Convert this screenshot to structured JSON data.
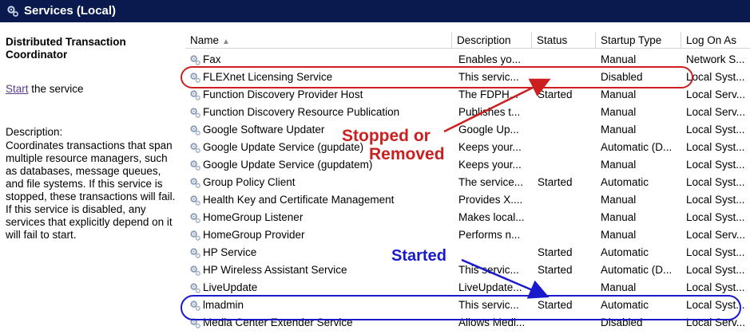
{
  "window": {
    "title": "Services (Local)"
  },
  "left_pane": {
    "service_name": "Distributed Transaction Coordinator",
    "action_link": "Start",
    "action_suffix": " the service",
    "description_label": "Description:",
    "description": "Coordinates transactions that span multiple resource managers, such as databases, message queues, and file systems. If this service is stopped, these transactions will fail. If this service is disabled, any services that explicitly depend on it will fail to start."
  },
  "columns": {
    "name": "Name",
    "description": "Description",
    "status": "Status",
    "startup_type": "Startup Type",
    "log_on_as": "Log On As"
  },
  "services": [
    {
      "name": "Fax",
      "description": "Enables yo...",
      "status": "",
      "startup": "Manual",
      "logon": "Network S..."
    },
    {
      "name": "FLEXnet Licensing Service",
      "description": "This servic...",
      "status": "",
      "startup": "Disabled",
      "logon": "Local Syst..."
    },
    {
      "name": "Function Discovery Provider Host",
      "description": "The FDPH...",
      "status": "Started",
      "startup": "Manual",
      "logon": "Local Serv..."
    },
    {
      "name": "Function Discovery Resource Publication",
      "description": "Publishes t...",
      "status": "",
      "startup": "Manual",
      "logon": "Local Serv..."
    },
    {
      "name": "Google Software Updater",
      "description": "Google Up...",
      "status": "",
      "startup": "Manual",
      "logon": "Local Syst..."
    },
    {
      "name": "Google Update Service (gupdate)",
      "description": "Keeps your...",
      "status": "",
      "startup": "Automatic (D...",
      "logon": "Local Syst..."
    },
    {
      "name": "Google Update Service (gupdatem)",
      "description": "Keeps your...",
      "status": "",
      "startup": "Manual",
      "logon": "Local Syst..."
    },
    {
      "name": "Group Policy Client",
      "description": "The service...",
      "status": "Started",
      "startup": "Automatic",
      "logon": "Local Syst..."
    },
    {
      "name": "Health Key and Certificate Management",
      "description": "Provides X....",
      "status": "",
      "startup": "Manual",
      "logon": "Local Syst..."
    },
    {
      "name": "HomeGroup Listener",
      "description": "Makes local...",
      "status": "",
      "startup": "Manual",
      "logon": "Local Syst..."
    },
    {
      "name": "HomeGroup Provider",
      "description": "Performs n...",
      "status": "",
      "startup": "Manual",
      "logon": "Local Serv..."
    },
    {
      "name": "HP Service",
      "description": "",
      "status": "Started",
      "startup": "Automatic",
      "logon": "Local Syst..."
    },
    {
      "name": "HP Wireless Assistant Service",
      "description": "This servic...",
      "status": "Started",
      "startup": "Automatic (D...",
      "logon": "Local Syst..."
    },
    {
      "name": "LiveUpdate",
      "description": "LiveUpdate...",
      "status": "",
      "startup": "Manual",
      "logon": "Local Syst..."
    },
    {
      "name": "lmadmin",
      "description": "This servic...",
      "status": "Started",
      "startup": "Automatic",
      "logon": "Local Syst..."
    },
    {
      "name": "Media Center Extender Service",
      "description": "Allows Medi...",
      "status": "",
      "startup": "Disabled",
      "logon": "Local Serv..."
    }
  ],
  "annotations": {
    "stopped_line1": "Stopped or",
    "stopped_line2": "Removed",
    "started": "Started",
    "stopped_color": "#cc1f1f",
    "started_color": "#1a1acc"
  }
}
